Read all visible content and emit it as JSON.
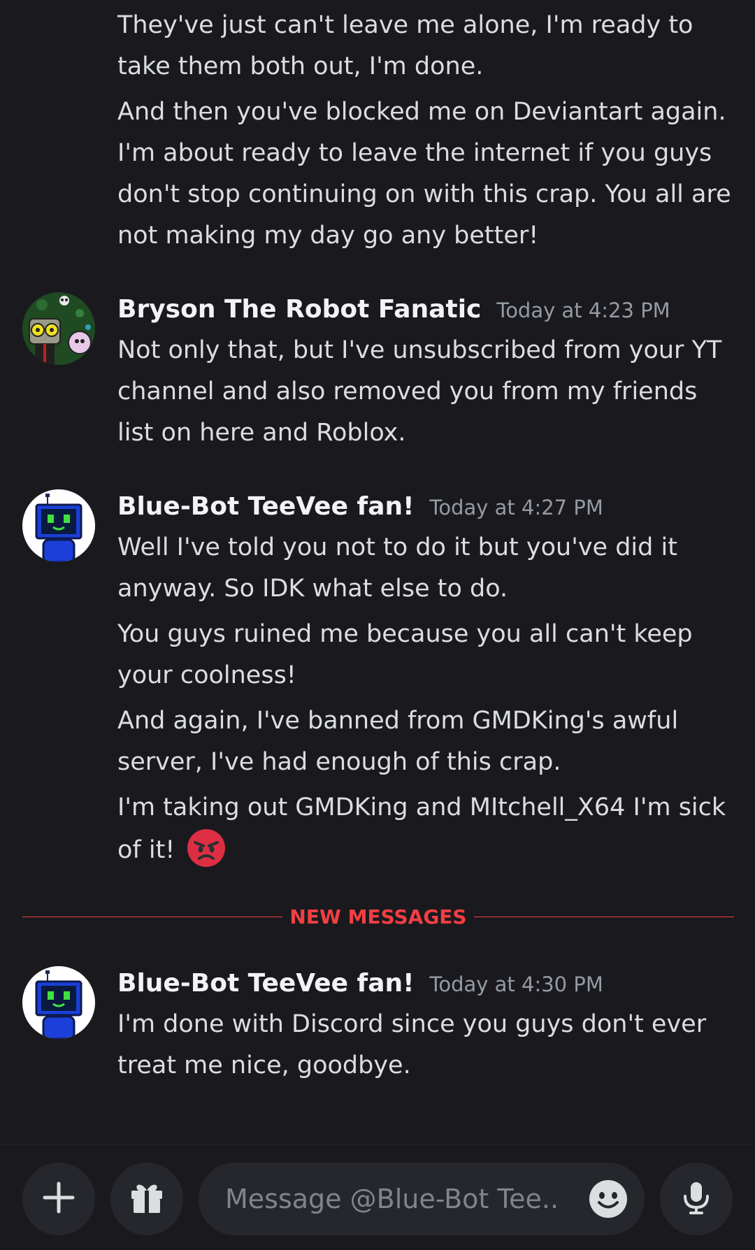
{
  "messages": {
    "group0": {
      "lines": [
        "They've just can't leave me alone, I'm ready to take them both out, I'm done.",
        "And then you've blocked me on Deviantart again. I'm about ready to leave the internet if you guys don't stop continuing on with this crap. You all are not making my day go any better!"
      ]
    },
    "group1": {
      "author": "Bryson The Robot Fanatic",
      "timestamp": "Today at 4:23 PM",
      "lines": [
        "Not only that, but I've unsubscribed from your YT channel and also removed you from my friends list on here and Roblox."
      ]
    },
    "group2": {
      "author": "Blue-Bot TeeVee fan!",
      "timestamp": "Today at 4:27 PM",
      "lines": [
        "Well I've told you not to do it but you've did it anyway. So IDK what else to do.",
        "You guys ruined me because you all can't keep your coolness!",
        "And again, I've banned from GMDKing's awful server, I've had enough of this crap.",
        "I'm taking out GMDKing and MItchell_X64 I'm sick of it!"
      ]
    },
    "group3": {
      "author": "Blue-Bot TeeVee fan!",
      "timestamp": "Today at 4:30 PM",
      "lines": [
        "I'm done with Discord since you guys don't ever treat me nice, goodbye."
      ]
    }
  },
  "divider_label": "NEW MESSAGES",
  "composer": {
    "placeholder": "Message @Blue-Bot Tee...",
    "plus_icon": "plus-icon",
    "gift_icon": "gift-icon",
    "emoji_icon": "emoji-icon",
    "mic_icon": "microphone-icon"
  },
  "colors": {
    "background": "#1a1a1e",
    "new_messages_red": "#f23f43",
    "angry_emoji": "#dd2e44"
  }
}
